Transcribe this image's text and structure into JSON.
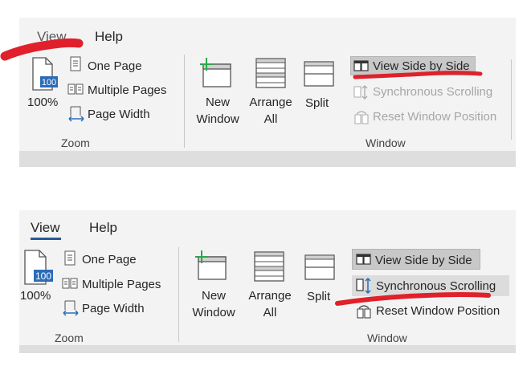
{
  "colors": {
    "ink_red": "#e0202a",
    "accent": "#2b579a",
    "ribbon_bg": "#f3f3f3",
    "highlight": "#c8c8c8"
  },
  "panels": [
    {
      "tabs": {
        "view": "View",
        "help": "Help"
      },
      "zoom": {
        "percent_label": "100%",
        "badge": "100",
        "one_page": "One Page",
        "multiple_pages": "Multiple Pages",
        "page_width": "Page Width",
        "group_label": "Zoom"
      },
      "window": {
        "new_window": [
          "New",
          "Window"
        ],
        "arrange_all": [
          "Arrange",
          "All"
        ],
        "split": "Split",
        "view_side_by_side": "View Side by Side",
        "synchronous_scrolling": "Synchronous Scrolling",
        "reset_window_position": "Reset Window Position",
        "group_label": "Window"
      }
    },
    {
      "tabs": {
        "view": "View",
        "help": "Help"
      },
      "zoom": {
        "percent_label": "100%",
        "badge": "100",
        "one_page": "One Page",
        "multiple_pages": "Multiple Pages",
        "page_width": "Page Width",
        "group_label": "Zoom"
      },
      "window": {
        "new_window": [
          "New",
          "Window"
        ],
        "arrange_all": [
          "Arrange",
          "All"
        ],
        "split": "Split",
        "view_side_by_side": "View Side by Side",
        "synchronous_scrolling": "Synchronous Scrolling",
        "reset_window_position": "Reset Window Position",
        "group_label": "Window"
      }
    }
  ]
}
